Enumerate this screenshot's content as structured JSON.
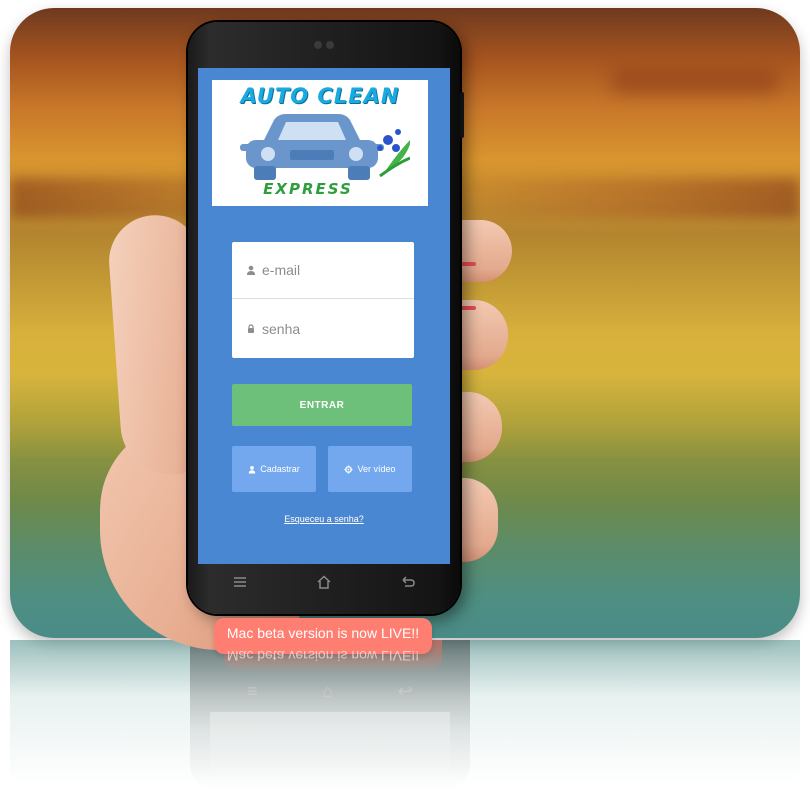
{
  "app": {
    "logo_top": "AUTO CLEAN",
    "logo_bottom": "EXPRESS"
  },
  "login": {
    "email_placeholder": "e-mail",
    "password_placeholder": "senha",
    "enter_label": "ENTRAR",
    "register_label": "Cadastrar",
    "video_label": "Ver vídeo",
    "forgot_label": "Esqueceu a senha?"
  },
  "nav": {
    "menu_icon": "menu-icon",
    "home_icon": "home-icon",
    "back_icon": "back-icon"
  },
  "banner": {
    "text": "Mac beta version is now LIVE!!"
  },
  "colors": {
    "screen_bg": "#4a87d2",
    "enter_button": "#6cc07a",
    "secondary_button": "#74a8ee",
    "banner": "#ff7e72",
    "logo_blue": "#1aa9e0",
    "logo_green": "#2e9e3a"
  }
}
